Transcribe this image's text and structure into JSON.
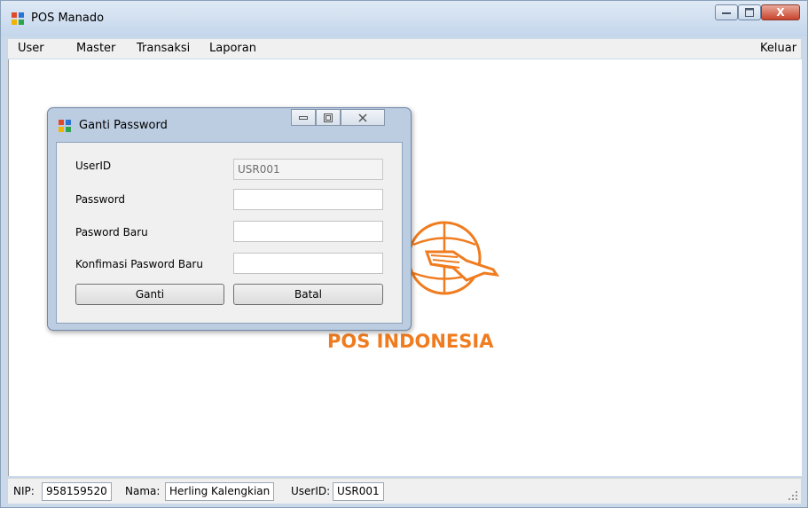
{
  "window": {
    "title": "POS Manado",
    "minimize_icon": "minimize-icon",
    "maximize_icon": "maximize-icon",
    "close_label": "X"
  },
  "menu": {
    "items": [
      "User",
      "Master",
      "Transaksi",
      "Laporan"
    ],
    "logout": "Keluar"
  },
  "logo": {
    "text": "POS INDONESIA",
    "color": "#f07c1f"
  },
  "dialog": {
    "title": "Ganti Password",
    "fields": [
      {
        "label": "UserID",
        "value": "USR001",
        "placeholder": "",
        "disabled": true
      },
      {
        "label": "Password",
        "value": "",
        "placeholder": ""
      },
      {
        "label": "Pasword Baru",
        "value": "",
        "placeholder": ""
      },
      {
        "label": "Konfimasi Pasword Baru",
        "value": "",
        "placeholder": ""
      }
    ],
    "buttons": {
      "submit": "Ganti",
      "cancel": "Batal"
    }
  },
  "status": {
    "nip_label": "NIP:",
    "nip_value": "958159520",
    "nama_label": "Nama:",
    "nama_value": "Herling Kalengkian",
    "userid_label": "UserID:",
    "userid_value": "USR001"
  }
}
